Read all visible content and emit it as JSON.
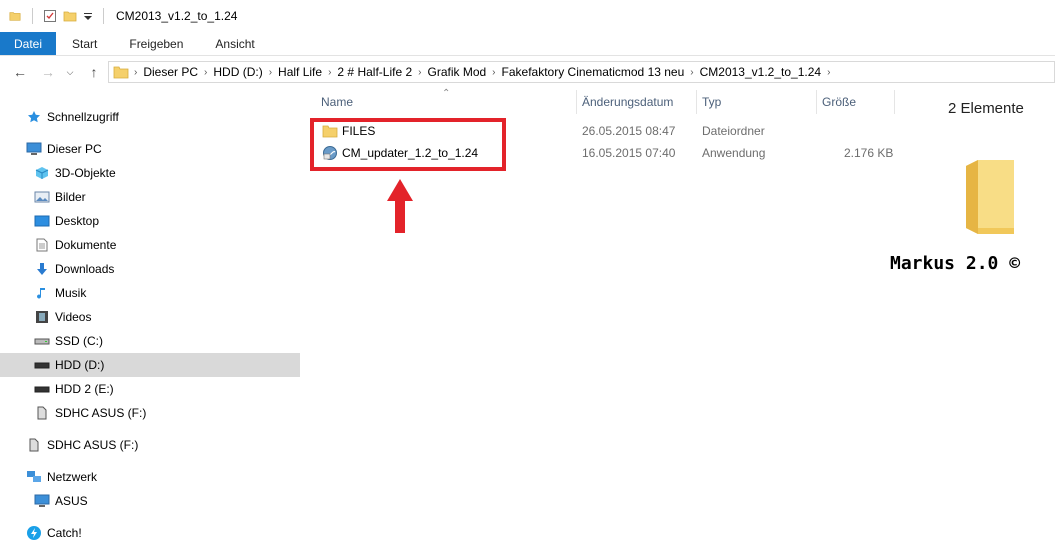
{
  "window": {
    "title": "CM2013_v1.2_to_1.24"
  },
  "ribbon": {
    "tabs": [
      "Datei",
      "Start",
      "Freigeben",
      "Ansicht"
    ]
  },
  "address": {
    "crumbs": [
      "Dieser PC",
      "HDD (D:)",
      "Half Life",
      "2 # Half-Life 2",
      "Grafik Mod",
      "Fakefaktory Cinematicmod 13 neu",
      "CM2013_v1.2_to_1.24"
    ]
  },
  "sidebar": {
    "quick_access": "Schnellzugriff",
    "this_pc": "Dieser PC",
    "pc_items": [
      "3D-Objekte",
      "Bilder",
      "Desktop",
      "Dokumente",
      "Downloads",
      "Musik",
      "Videos",
      "SSD  (C:)",
      "HDD (D:)",
      "HDD 2 (E:)",
      "SDHC ASUS (F:)"
    ],
    "removable": "SDHC ASUS (F:)",
    "network": "Netzwerk",
    "network_items": [
      "ASUS"
    ],
    "catch": "Catch!"
  },
  "columns": {
    "name": "Name",
    "date": "Änderungsdatum",
    "type": "Typ",
    "size": "Größe"
  },
  "files": [
    {
      "name": "FILES",
      "date": "26.05.2015 08:47",
      "type": "Dateiordner",
      "size": ""
    },
    {
      "name": "CM_updater_1.2_to_1.24",
      "date": "16.05.2015 07:40",
      "type": "Anwendung",
      "size": "2.176 KB"
    }
  ],
  "details": {
    "count": "2 Elemente"
  },
  "watermark": "Markus 2.0 ©",
  "colors": {
    "accent": "#1979ca",
    "highlight": "#e3232a",
    "folder": "#f5d06b",
    "selected": "#d9d9d9"
  }
}
